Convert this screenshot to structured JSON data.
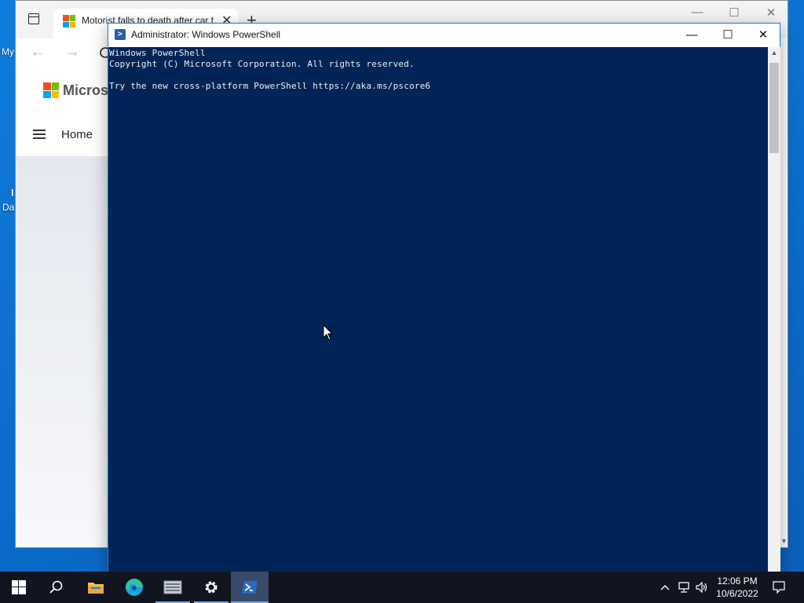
{
  "desktop": {
    "label_top": "My",
    "label_mid_1": "I",
    "label_mid_2": "Da"
  },
  "browser": {
    "tab_title": "Motorist falls to death after car t",
    "tab_close": "✕",
    "new_tab": "+",
    "back": "←",
    "forward": "→",
    "brand_text": "Microso",
    "nav_home": "Home",
    "win_minimize": "—",
    "win_maximize": "☐",
    "win_close": "✕"
  },
  "powershell": {
    "title": "Administrator: Windows PowerShell",
    "icon_glyph": ">",
    "minimize": "—",
    "maximize": "☐",
    "close": "✕",
    "lines": [
      "Windows PowerShell",
      "Copyright (C) Microsoft Corporation. All rights reserved.",
      "",
      "Try the new cross-platform PowerShell https://aka.ms/pscore6"
    ],
    "scroll_up": "▲",
    "scroll_down": "▼"
  },
  "taskbar": {
    "apps": [
      {
        "name": "start",
        "icon": "windows-logo"
      },
      {
        "name": "search",
        "icon": "search-icon"
      },
      {
        "name": "file-explorer",
        "icon": "folder-icon"
      },
      {
        "name": "edge",
        "icon": "edge-icon"
      },
      {
        "name": "server-manager",
        "icon": "server-icon"
      },
      {
        "name": "settings",
        "icon": "gear-icon"
      },
      {
        "name": "powershell",
        "icon": "powershell-icon",
        "active": true
      }
    ],
    "tray": {
      "chevron": "^",
      "volume": "🔊"
    },
    "time": "12:06 PM",
    "date": "10/6/2022"
  },
  "colors": {
    "console_bg": "#012456",
    "console_text": "#eeedf0",
    "taskbar_bg": "#101520",
    "desktop_bg": "#0a74d6"
  }
}
